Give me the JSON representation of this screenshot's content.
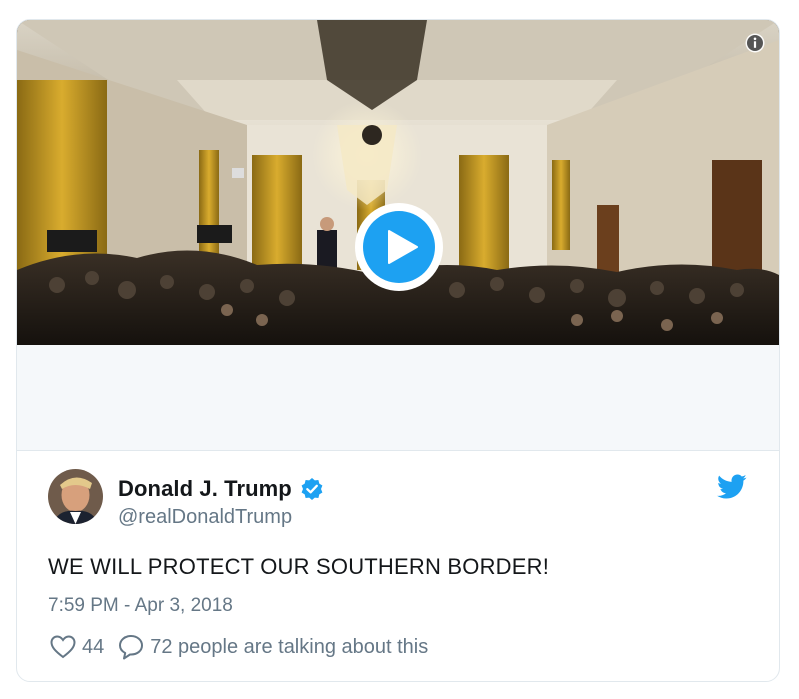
{
  "tweet": {
    "display_name": "Donald J. Trump",
    "handle": "@realDonaldTrump",
    "text": "WE WILL PROTECT OUR SOUTHERN BORDER!",
    "timestamp": "7:59 PM - Apr 3, 2018",
    "likes": "44",
    "conversation": "72 people are talking about this",
    "verified": true
  },
  "media": {
    "type": "video",
    "controls": [
      "info-icon",
      "play-icon"
    ]
  },
  "colors": {
    "accent": "#1da1f2",
    "text": "#14171a",
    "secondary_text": "#657786",
    "border": "#e1e8ed",
    "placeholder_bg": "#f5f8fa"
  }
}
